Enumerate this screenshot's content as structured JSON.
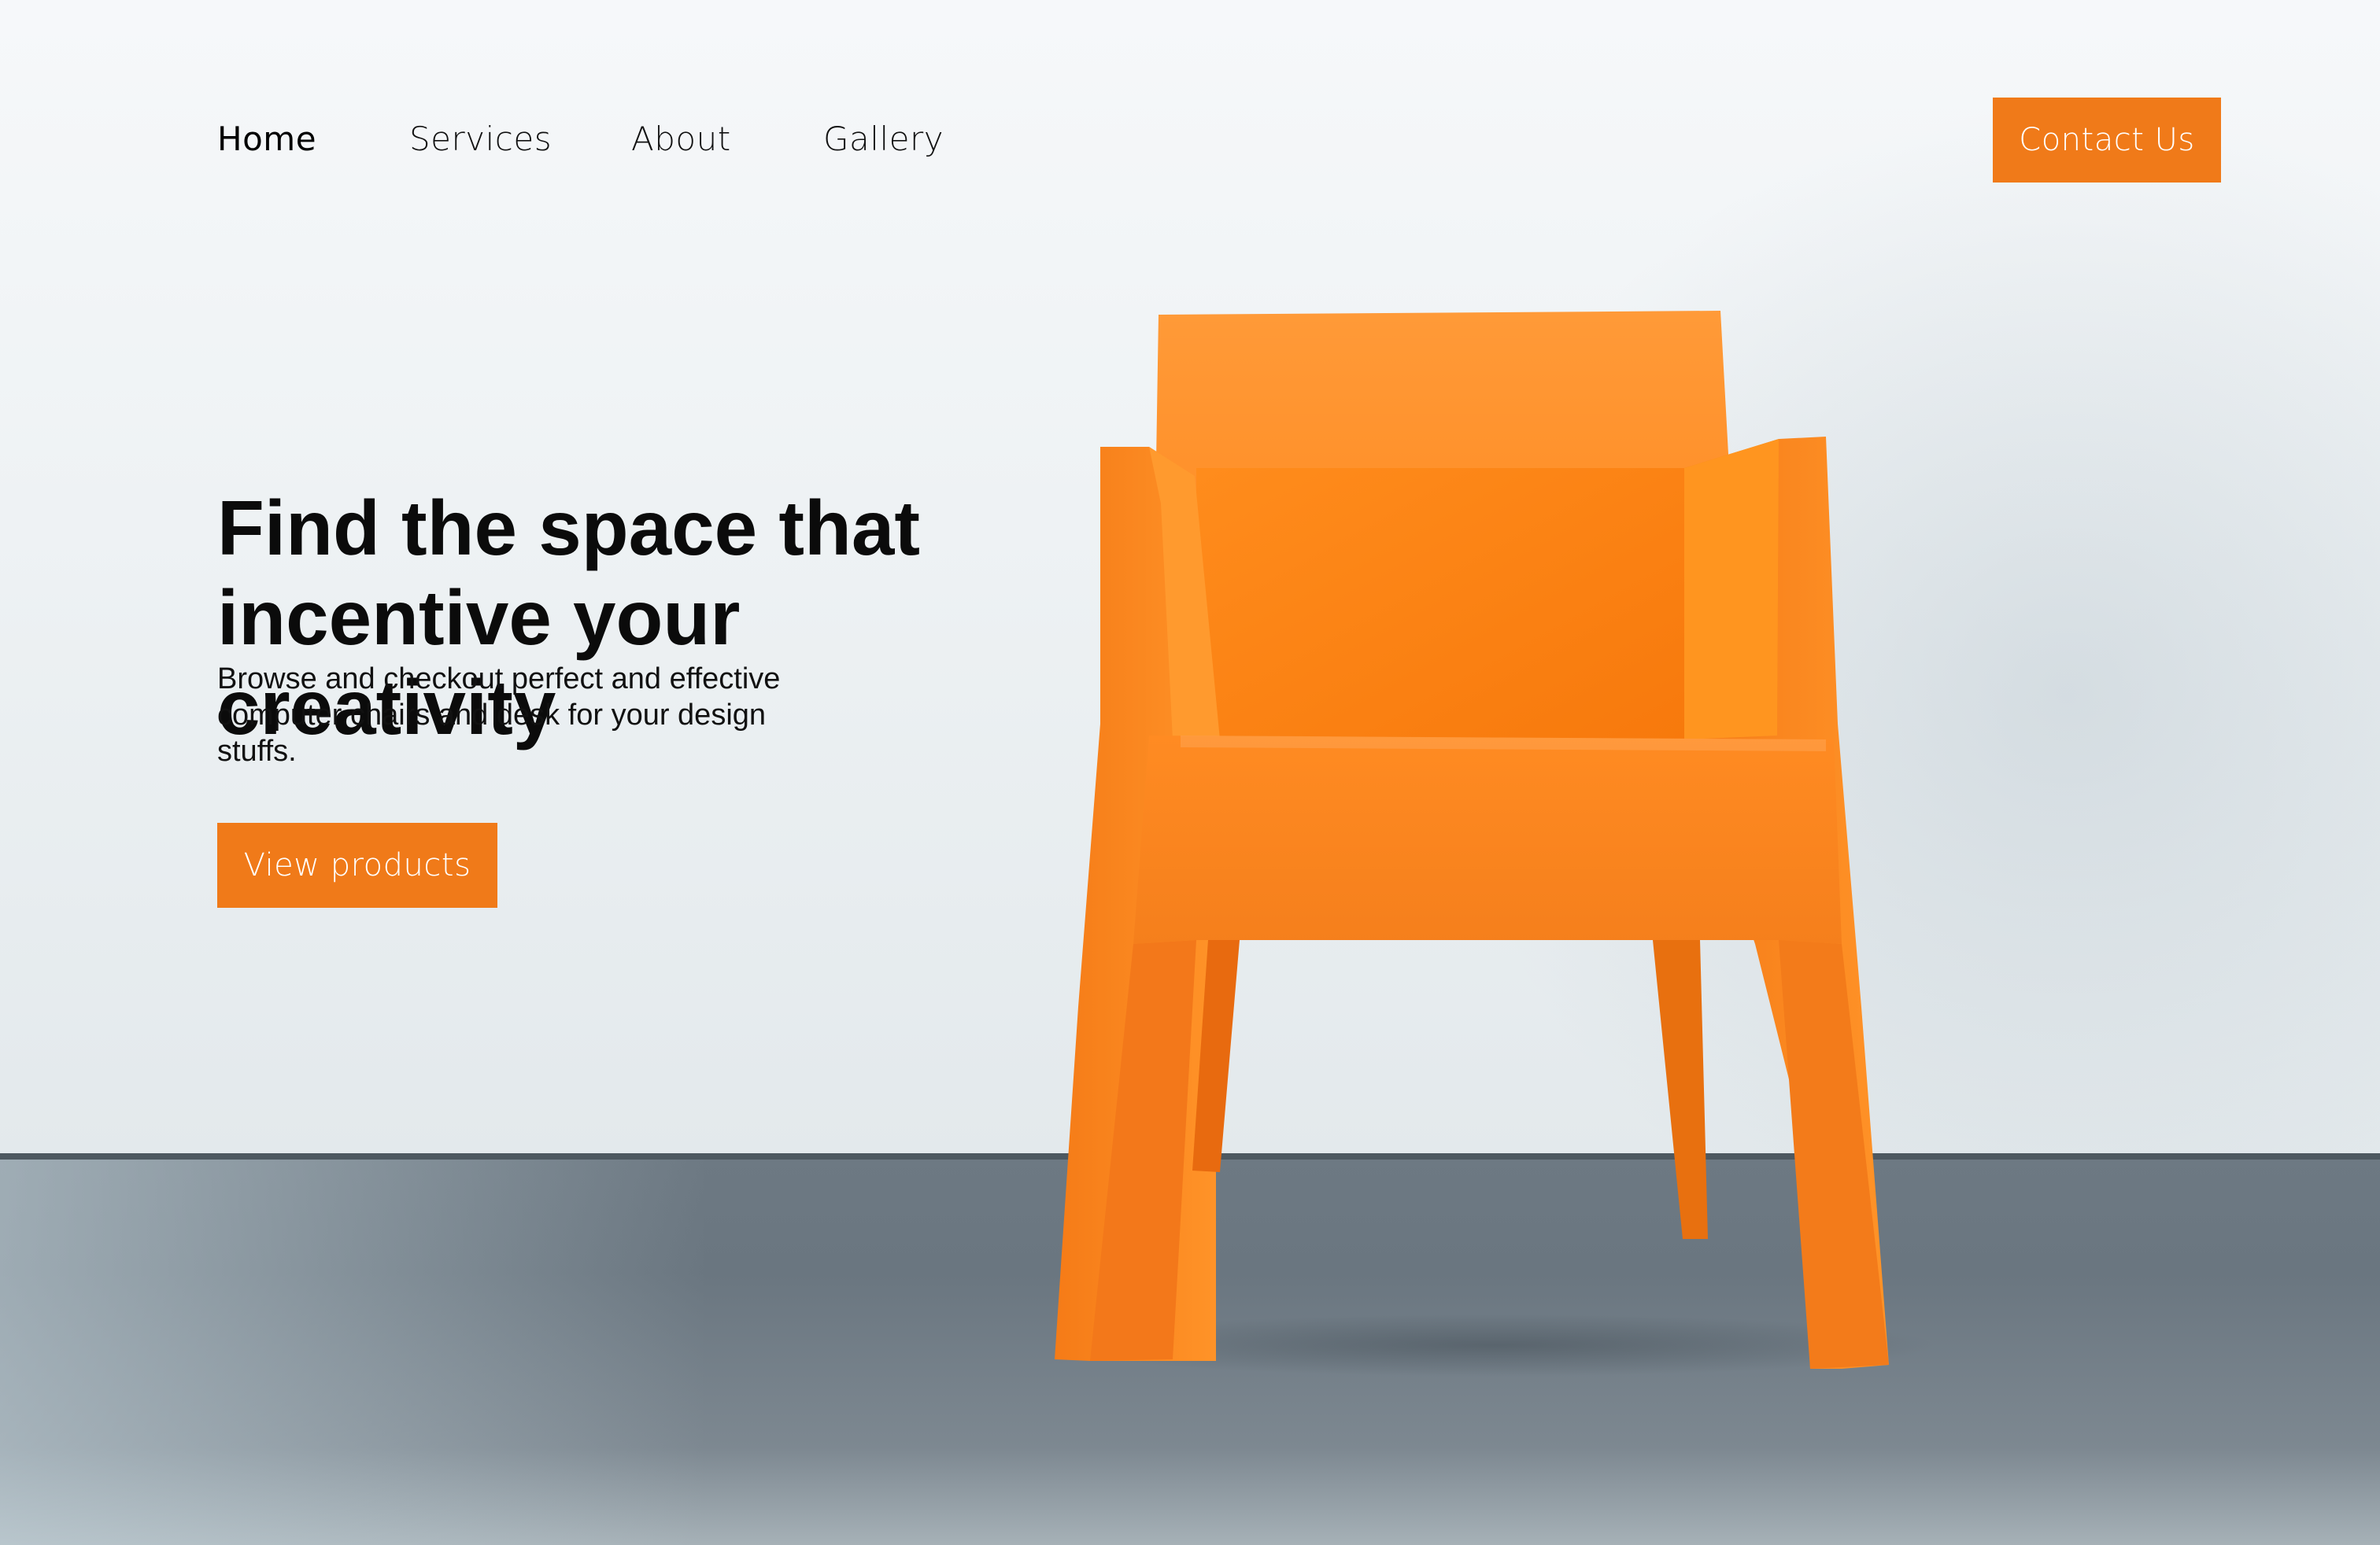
{
  "nav": {
    "items": [
      {
        "label": "Home"
      },
      {
        "label": "Services"
      },
      {
        "label": "About"
      },
      {
        "label": "Gallery"
      }
    ],
    "active": "Home",
    "contact_label": "Contact Us"
  },
  "hero": {
    "headline": "Find the space that\nincentive your creativity",
    "subtext": "Browse and checkout perfect and effective\ncomputer chairs and  desk for  your design\nstuffs.",
    "cta_label": "View products",
    "image_subject": "orange-armchair"
  },
  "colors": {
    "accent": "#f07a19",
    "chair": "#ff8a1e",
    "text": "#0b0b0b",
    "wall": "#eef2f5",
    "floor": "#6d7983"
  }
}
